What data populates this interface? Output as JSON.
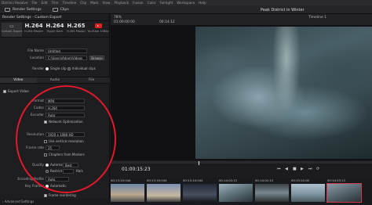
{
  "menubar": [
    "DaVinci Resolve",
    "File",
    "Edit",
    "Trim",
    "Timeline",
    "Clip",
    "Mark",
    "View",
    "Playback",
    "Fusion",
    "Color",
    "Fairlight",
    "Workspace",
    "Help"
  ],
  "toolbar": {
    "render_settings": "Render Settings",
    "clips": "Clips",
    "zoom": "78%",
    "timecode_a": "01:00:00:00",
    "timecode_b": "00:14:12",
    "project_title": "Peak District in Winter",
    "timeline_name": "Timeline 1"
  },
  "render_panel": {
    "title": "Render Settings - Custom Export",
    "presets": [
      {
        "big": "",
        "sub": "Custom Export"
      },
      {
        "big": "H.264",
        "sub": "H.264 Master"
      },
      {
        "big": "H.264",
        "sub": "Hyper Deck"
      },
      {
        "big": "H.265",
        "sub": "H.265 Master"
      },
      {
        "big": "",
        "sub": "YouTube 1080p"
      }
    ],
    "file_name_label": "File Name",
    "file_name_value": "Untitled",
    "location_label": "Location",
    "location_value": "C:\\Users\\Adam\\Videos",
    "browse_label": "Browse",
    "render_label": "Render",
    "single_clip": "Single clip",
    "individual_clips": "Individual clips",
    "tabs": [
      "Video",
      "Audio",
      "File"
    ],
    "export_video": "Export Video",
    "format_label": "Format",
    "format_value": "MP4",
    "codec_label": "Codec",
    "codec_value": "H.264",
    "encoder_label": "Encoder",
    "encoder_value": "Auto",
    "network_opt": "Network Optimization",
    "resolution_label": "Resolution",
    "resolution_value": "1920 x 1080 HD",
    "custom_res": "Use vertical resolution",
    "frame_rate_label": "Frame rate",
    "frame_rate_value": "25",
    "chapters": "Chapters from Markers",
    "quality_label": "Quality",
    "quality_auto": "Automatic",
    "quality_best": "Best",
    "restrict": "Restrict to",
    "kbs": "Kb/s",
    "encode_profile_label": "Encoding Profile",
    "encode_profile_value": "Auto",
    "key_frames_label": "Key Frames",
    "key_frames_value": "Automatic",
    "frame_reorder": "Frame reordering",
    "advanced": "Advanced Settings"
  },
  "viewer": {
    "timecode": "01:00:15:23"
  },
  "clips": [
    {
      "tc": "00:13:10:044",
      "num": "01",
      "codec": "H.264"
    },
    {
      "tc": "00:13:10:044",
      "num": "02",
      "codec": "H.264"
    },
    {
      "tc": "00:13:10:044",
      "num": "03",
      "codec": "H.264"
    },
    {
      "tc": "00:14:02:12",
      "num": "04",
      "codec": "H.264"
    },
    {
      "tc": "00:14:02:12",
      "num": "05",
      "codec": "H.264"
    },
    {
      "tc": "00:13:22:02",
      "num": "06",
      "codec": "H.264"
    },
    {
      "tc": "00:14:53:12",
      "num": "07",
      "codec": "H.264"
    }
  ]
}
